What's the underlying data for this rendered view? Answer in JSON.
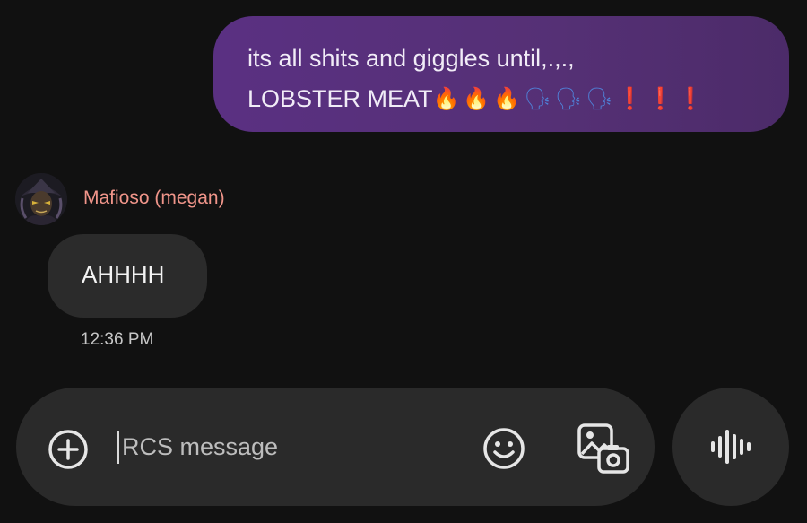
{
  "outgoing_message": {
    "line1": "its all shits and giggles until,.,.,",
    "line2_text": "LOBSTER MEAT",
    "fire_emojis": "🔥🔥🔥",
    "speaking_emojis": "🗣🗣🗣",
    "exclamations": "❗❗❗"
  },
  "incoming_message": {
    "sender": "Mafioso (megan)",
    "text": "AHHHH",
    "time": "12:36 PM"
  },
  "compose": {
    "placeholder": "RCS message"
  },
  "icons": {
    "add": "plus-circle-icon",
    "emoji": "smiley-face-icon",
    "media": "gallery-camera-icon",
    "voice": "voice-waveform-icon",
    "avatar": "user-avatar"
  },
  "colors": {
    "background": "#111111",
    "outgoing_bubble": "#553075",
    "incoming_bubble": "#2b2b2b",
    "sender_name": "#f0958a",
    "compose_bar": "#2a2a2a"
  }
}
